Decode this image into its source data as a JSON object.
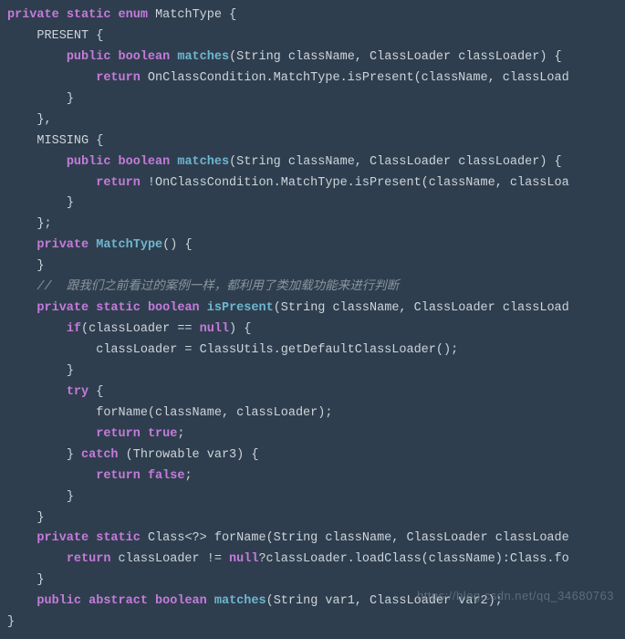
{
  "code": {
    "l0": {
      "kw1": "private",
      "kw2": "static",
      "kw3": "enum",
      "name": "MatchType",
      "t": " {"
    },
    "l1": {
      "name": "PRESENT",
      "t": " {"
    },
    "l2": {
      "kw1": "public",
      "kw2": "boolean",
      "fn": "matches",
      "sig": "(String className, ClassLoader classLoader) {"
    },
    "l3": {
      "kw": "return",
      "t": " OnClassCondition.MatchType.isPresent(className, classLoad"
    },
    "l4": {
      "t": "}"
    },
    "l5": {
      "t": "},"
    },
    "l6": {
      "name": "MISSING",
      "t": " {"
    },
    "l7": {
      "kw1": "public",
      "kw2": "boolean",
      "fn": "matches",
      "sig": "(String className, ClassLoader classLoader) {"
    },
    "l8": {
      "kw": "return",
      "t": " !OnClassCondition.MatchType.isPresent(className, classLoa"
    },
    "l9": {
      "t": "}"
    },
    "l10": {
      "t": "};"
    },
    "l11": {
      "kw": "private",
      "fn": "MatchType",
      "t": "() {"
    },
    "l12": {
      "t": "}"
    },
    "l13": {
      "t": "//  跟我们之前看过的案例一样，都利用了类加载功能来进行判断"
    },
    "l14": {
      "kw1": "private",
      "kw2": "static",
      "kw3": "boolean",
      "fn": "isPresent",
      "sig": "(String className, ClassLoader classLoad"
    },
    "l15": {
      "kw": "if",
      "t1": "(classLoader == ",
      "nul": "null",
      "t2": ") {"
    },
    "l16": {
      "t": "classLoader = ClassUtils.getDefaultClassLoader();"
    },
    "l17": {
      "t": "}"
    },
    "l18": {
      "kw": "try",
      "t": " {"
    },
    "l19": {
      "t": "forName(className, classLoader);"
    },
    "l20": {
      "kw": "return",
      "nul": "true",
      "t": ";"
    },
    "l21": {
      "t1": "} ",
      "kw": "catch",
      "t2": " (Throwable var3) {"
    },
    "l22": {
      "kw": "return",
      "nul": "false",
      "t": ";"
    },
    "l23": {
      "t": "}"
    },
    "l24": {
      "t": "}"
    },
    "l25": {
      "kw1": "private",
      "kw2": "static",
      "t1": " Class<?> forName(String className, ClassLoader classLoade"
    },
    "l26": {
      "kw": "return",
      "t1": " classLoader != ",
      "nul": "null",
      "t2": "?classLoader.loadClass(className):Class.fo"
    },
    "l27": {
      "t": "}"
    },
    "l28": {
      "kw1": "public",
      "kw2": "abstract",
      "kw3": "boolean",
      "fn": "matches",
      "sig": "(String var1, ClassLoader var2);"
    },
    "l29": {
      "t": "}"
    }
  },
  "watermark": "https://blog.csdn.net/qq_34680763"
}
